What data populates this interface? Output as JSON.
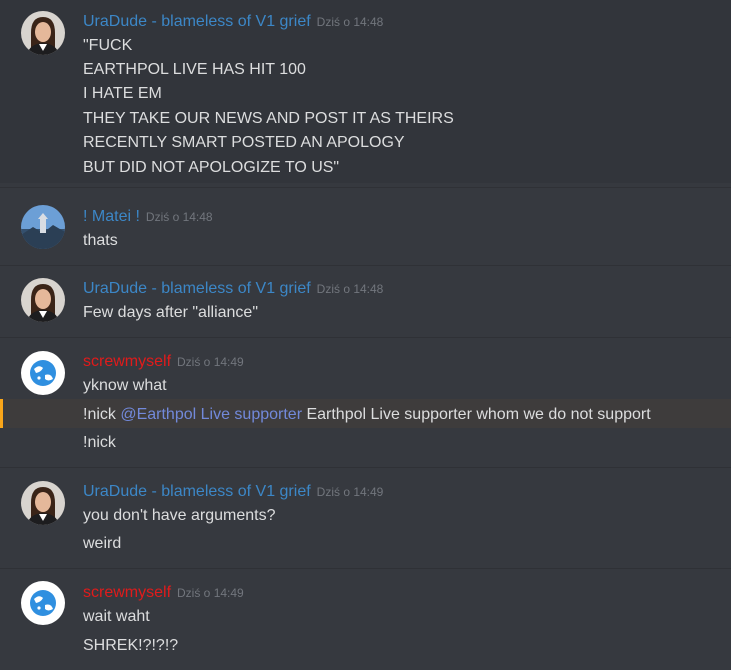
{
  "colors": {
    "background": "#36393f",
    "username_blue": "#3c87c7",
    "username_red": "#e01b1b",
    "mention": "#7289da",
    "mention_bar": "#faa61a",
    "timestamp": "#72767d"
  },
  "messages": [
    {
      "author": "UraDude -  blameless of V1 grief",
      "timestamp": "Dziś o 14:48",
      "lines": [
        "\"FUCK",
        "EARTHPOL LIVE HAS HIT 100",
        "I HATE EM",
        "THEY TAKE OUR NEWS AND POST IT AS THEIRS",
        "RECENTLY SMART POSTED AN APOLOGY",
        "BUT DID NOT APOLOGIZE TO US\""
      ]
    },
    {
      "author": "! Matei !",
      "timestamp": "Dziś o 14:48",
      "lines": [
        "thats"
      ]
    },
    {
      "author": "UraDude -  blameless of V1 grief",
      "timestamp": "Dziś o 14:48",
      "lines": [
        "Few days after \"alliance\""
      ]
    },
    {
      "author": "screwmyself",
      "timestamp": "Dziś o 14:49",
      "lines": [
        "yknow what",
        {
          "prefix": "!nick ",
          "mention": "@Earthpol Live supporter",
          "suffix": " Earthpol Live supporter whom we do not support"
        },
        "!nick"
      ]
    },
    {
      "author": "UraDude -  blameless of V1 grief",
      "timestamp": "Dziś o 14:49",
      "lines": [
        "you don't have arguments?",
        "weird"
      ]
    },
    {
      "author": "screwmyself",
      "timestamp": "Dziś o 14:49",
      "lines": [
        "wait waht",
        "SHREK!?!?!?"
      ]
    }
  ]
}
